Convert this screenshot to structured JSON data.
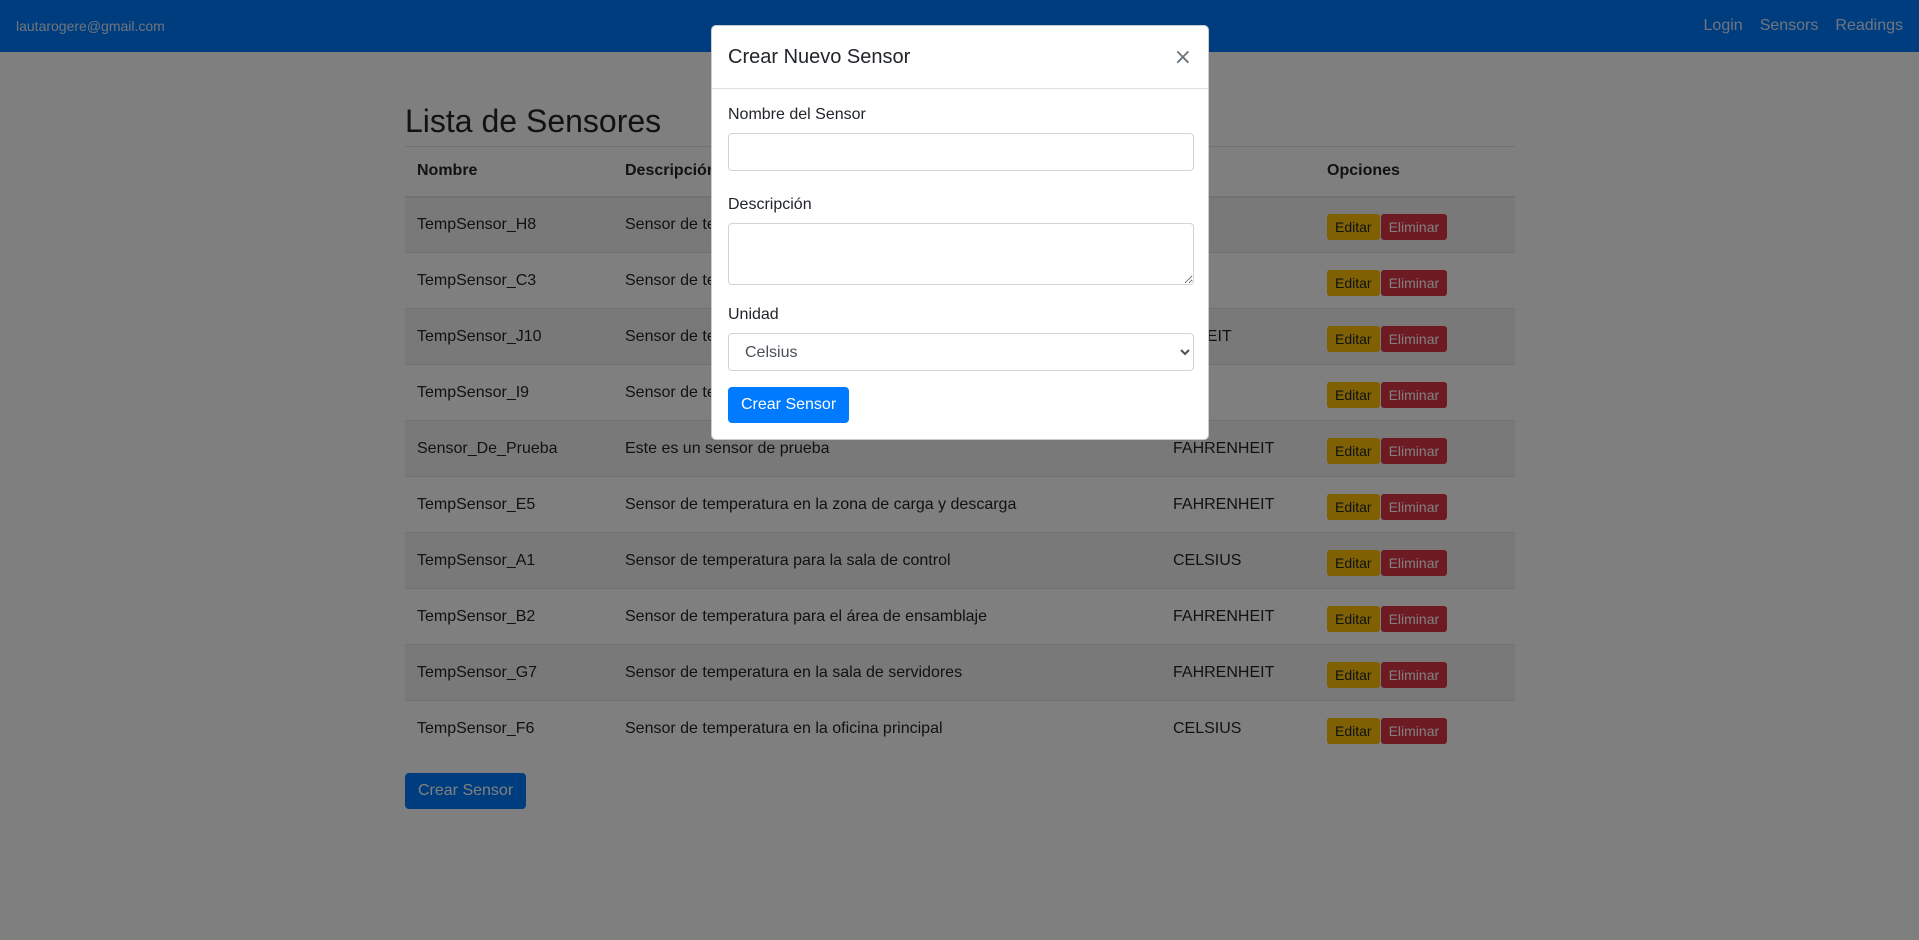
{
  "navbar": {
    "user_email": "lautarogere@gmail.com",
    "links": [
      "Login",
      "Sensors",
      "Readings"
    ]
  },
  "page": {
    "title": "Lista de Sensores",
    "columns": [
      "Nombre",
      "Descripción",
      "Unidad",
      "Opciones"
    ],
    "visible_columns": [
      "Nombre",
      "Descripción",
      "ad",
      "Opciones"
    ],
    "rows": [
      {
        "nombre": "TempSensor_H8",
        "descripcion": "Sensor de te",
        "unidad": "IUS"
      },
      {
        "nombre": "TempSensor_C3",
        "descripcion": "Sensor de te",
        "unidad": "IUS"
      },
      {
        "nombre": "TempSensor_J10",
        "descripcion": "Sensor de te",
        "unidad": "ENHEIT"
      },
      {
        "nombre": "TempSensor_I9",
        "descripcion": "Sensor de te",
        "unidad": "IUS"
      },
      {
        "nombre": "Sensor_De_Prueba",
        "descripcion": "Este es un sensor de prueba",
        "unidad": "FAHRENHEIT"
      },
      {
        "nombre": "TempSensor_E5",
        "descripcion": "Sensor de temperatura en la zona de carga y descarga",
        "unidad": "FAHRENHEIT"
      },
      {
        "nombre": "TempSensor_A1",
        "descripcion": "Sensor de temperatura para la sala de control",
        "unidad": "CELSIUS"
      },
      {
        "nombre": "TempSensor_B2",
        "descripcion": "Sensor de temperatura para el área de ensamblaje",
        "unidad": "FAHRENHEIT"
      },
      {
        "nombre": "TempSensor_G7",
        "descripcion": "Sensor de temperatura en la sala de servidores",
        "unidad": "FAHRENHEIT"
      },
      {
        "nombre": "TempSensor_F6",
        "descripcion": "Sensor de temperatura en la oficina principal",
        "unidad": "CELSIUS"
      }
    ],
    "edit_label": "Editar",
    "delete_label": "Eliminar",
    "create_button": "Crear Sensor"
  },
  "modal": {
    "title": "Crear Nuevo Sensor",
    "close_glyph": "×",
    "name_label": "Nombre del Sensor",
    "name_value": "",
    "description_label": "Descripción",
    "description_value": "",
    "unit_label": "Unidad",
    "unit_selected": "Celsius",
    "submit_label": "Crear Sensor"
  },
  "colors": {
    "primary": "#007bff",
    "warning": "#ffc107",
    "danger": "#dc3545"
  }
}
